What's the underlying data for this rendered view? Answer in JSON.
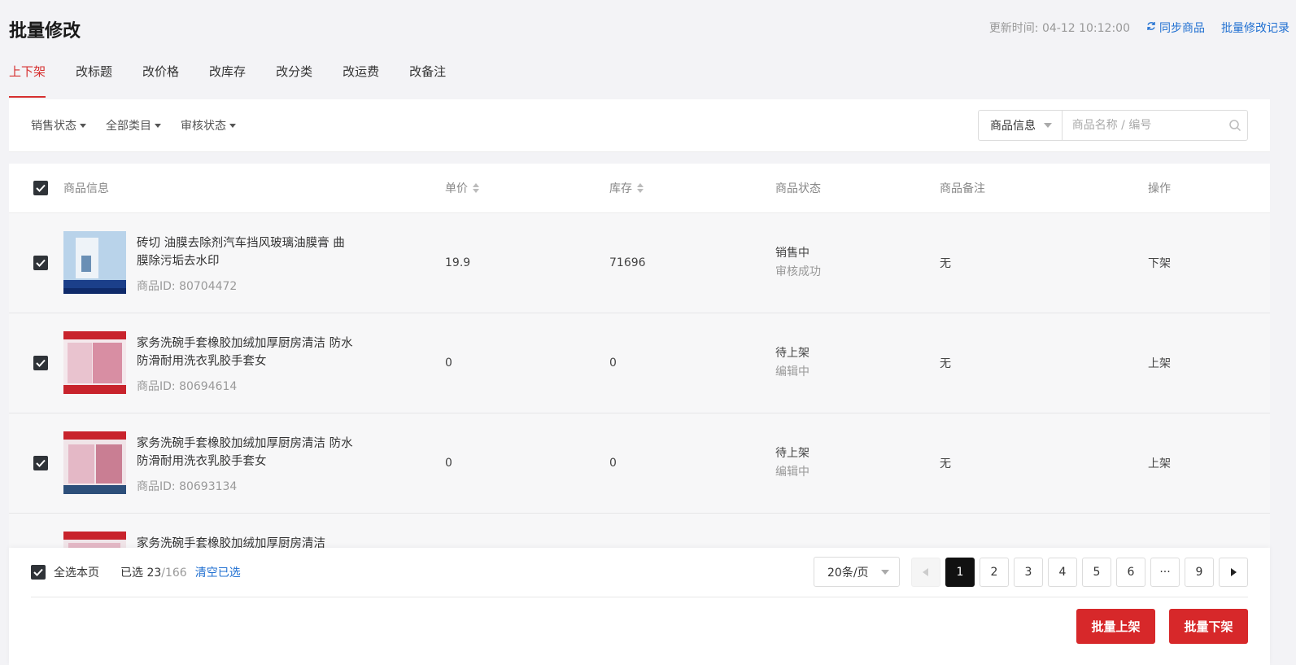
{
  "page": {
    "title": "批量修改"
  },
  "header": {
    "update_time": "更新时间: 04-12 10:12:00",
    "sync_label": "同步商品",
    "history_label": "批量修改记录"
  },
  "tabs": [
    {
      "label": "上下架",
      "active": true
    },
    {
      "label": "改标题"
    },
    {
      "label": "改价格"
    },
    {
      "label": "改库存"
    },
    {
      "label": "改分类"
    },
    {
      "label": "改运费"
    },
    {
      "label": "改备注"
    }
  ],
  "filters": {
    "sale_status": "销售状态",
    "category": "全部类目",
    "review_status": "审核状态",
    "search_type": "商品信息",
    "search_placeholder": "商品名称 / 编号"
  },
  "table": {
    "headers": {
      "product": "商品信息",
      "price": "单价",
      "stock": "库存",
      "status": "商品状态",
      "note": "商品备注",
      "action": "操作"
    },
    "rows": [
      {
        "title": "砖切 油膜去除剂汽车挡风玻璃油膜膏 曲膜除污垢去水印",
        "id": "商品ID: 80704472",
        "price": "19.9",
        "stock": "71696",
        "status1": "销售中",
        "status2": "审核成功",
        "note": "无",
        "action": "下架"
      },
      {
        "title": "家务洗碗手套橡胶加绒加厚厨房清洁 防水防滑耐用洗衣乳胶手套女",
        "id": "商品ID: 80694614",
        "price": "0",
        "stock": "0",
        "status1": "待上架",
        "status2": "编辑中",
        "note": "无",
        "action": "上架"
      },
      {
        "title": "家务洗碗手套橡胶加绒加厚厨房清洁 防水防滑耐用洗衣乳胶手套女",
        "id": "商品ID: 80693134",
        "price": "0",
        "stock": "0",
        "status1": "待上架",
        "status2": "编辑中",
        "note": "无",
        "action": "上架"
      },
      {
        "title": "家务洗碗手套橡胶加绒加厚厨房清洁",
        "id": "",
        "price": "",
        "stock": "",
        "status1": "",
        "status2": "",
        "note": "",
        "action": ""
      }
    ]
  },
  "footer": {
    "select_page": "全选本页",
    "selected_prefix": "已选 23",
    "selected_total": "/166",
    "clear": "清空已选",
    "page_size": "20条/页",
    "pages": [
      "1",
      "2",
      "3",
      "4",
      "5",
      "6",
      "···",
      "9"
    ],
    "batch_on": "批量上架",
    "batch_off": "批量下架"
  },
  "colors": {
    "accent": "#d62f2f",
    "link": "#1f6fd1",
    "button": "#d7282a"
  }
}
